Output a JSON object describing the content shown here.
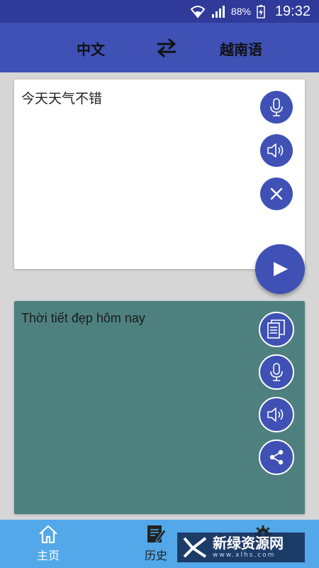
{
  "status_bar": {
    "battery": "88%",
    "time": "19:32"
  },
  "app_bar": {
    "source_language": "中文",
    "target_language": "越南语"
  },
  "input": {
    "text": "今天天气不错"
  },
  "output": {
    "text": "Thời tiết đẹp hôm nay"
  },
  "bottom_nav": {
    "home_label": "主页",
    "history_label": "历史"
  },
  "watermark": {
    "text": "新绿资源网",
    "sub": "www.xlhs.com"
  },
  "colors": {
    "status_bar": "#2f3a9a",
    "primary": "#3f51b5",
    "output_card": "#4f8080",
    "bottom_nav": "#52a8e8"
  }
}
